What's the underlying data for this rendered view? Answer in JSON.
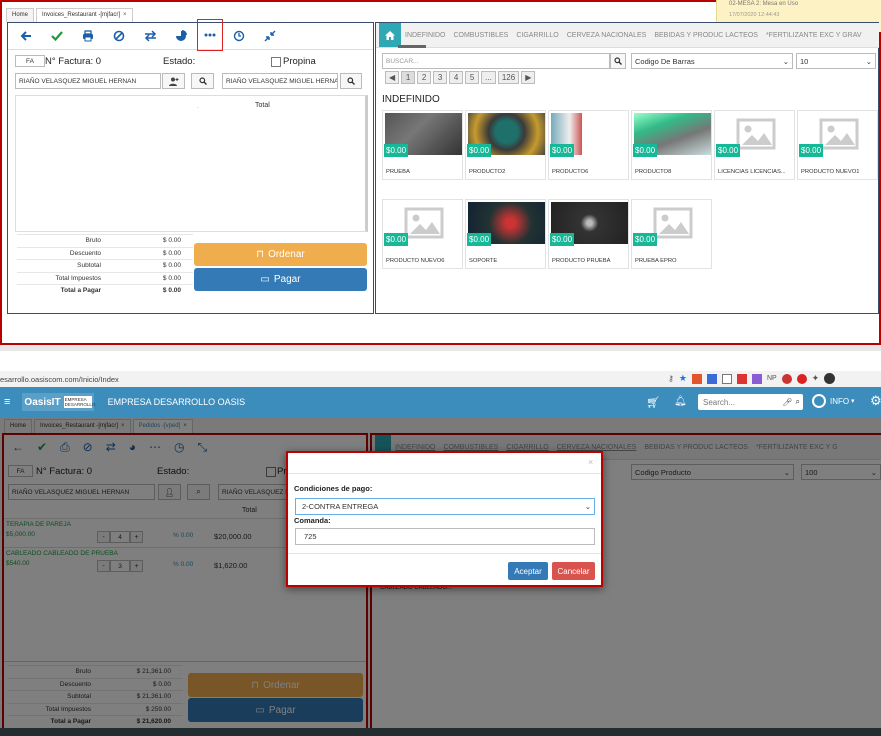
{
  "top": {
    "tabs": [
      {
        "label": "Home"
      },
      {
        "label": "Invoices_Restaurant -[mjfacr]",
        "close": "×"
      }
    ],
    "notification": {
      "line1": "02-MESA 2: Mesa en Uso",
      "line2": "17/07/2020 12:44:43"
    },
    "invoice": {
      "type_code": "FA",
      "number_label": "N° Factura: 0",
      "estado_label": "Estado:",
      "propina_label": "Propina",
      "client_left": "RIAÑO VELASQUEZ MIGUEL HERNAN",
      "client_right": "RIAÑO VELASQUEZ MIGUEL HERNAN",
      "total_header": "Total",
      "dot": "."
    },
    "totals": [
      {
        "k": "Bruto",
        "v": "$ 0.00"
      },
      {
        "k": "Descuento",
        "v": "$ 0.00"
      },
      {
        "k": "Subtotal",
        "v": "$ 0.00"
      },
      {
        "k": "Total Impuestos",
        "v": "$ 0.00"
      },
      {
        "k": "Total a Pagar",
        "v": "$ 0.00"
      }
    ],
    "buttons": {
      "ordenar": "Ordenar",
      "pagar": "Pagar"
    },
    "categories": [
      "INDEFINIDO",
      "COMBUSTIBLES",
      "CIGARRILLO",
      "CERVEZA NACIONALES",
      "BEBIDAS Y PRODUC LACTEOS",
      "*FERTILIZANTE EXC Y GRAV"
    ],
    "search_placeholder": "BUSCAR...",
    "filter_select": "Codigo De Barras",
    "page_size": "10",
    "pager": [
      "◀",
      "1",
      "2",
      "3",
      "4",
      "5",
      "...",
      "126",
      "▶"
    ],
    "section_title": "INDEFINIDO",
    "products": [
      {
        "name": "PRUEBA",
        "price": "$0.00"
      },
      {
        "name": "PRODUCTO2",
        "price": "$0.00"
      },
      {
        "name": "PRODUCTO6",
        "price": "$0.00"
      },
      {
        "name": "PRODUCTO8",
        "price": "$0.00"
      },
      {
        "name": "LICENCIAS LICENCIAS...",
        "price": "$0.00"
      },
      {
        "name": "PRODUCTO NUEVO1",
        "price": "$0.00"
      },
      {
        "name": "PRODUCTO NUEVO6",
        "price": "$0.00"
      },
      {
        "name": "SOPORTE",
        "price": "$0.00"
      },
      {
        "name": "PRODUCTO PRUEBA",
        "price": "$0.00"
      },
      {
        "name": "PRUEBA EPRO",
        "price": "$0.00"
      }
    ]
  },
  "bottom": {
    "url": "esarrollo.oasiscom.com/Inicio/Index",
    "browser_ext_np": "NP",
    "brand": "EMPRESA DESARROLLO OASIS",
    "logo_text": "OasisIT",
    "logo_sub": "EMPRESA DESARROLLO",
    "search_placeholder": "Search...",
    "user": "INFO",
    "tabs": [
      {
        "label": "Home"
      },
      {
        "label": "Invoices_Restaurant -[mjfacr]",
        "close": "×"
      },
      {
        "label": "Pedidos -[vped]",
        "close": "×"
      }
    ],
    "invoice": {
      "type_code": "FA",
      "number_label": "N° Factura: 0",
      "estado_label": "Estado:",
      "propina_label": "Pro",
      "client_left": "RIAÑO VELASQUEZ MIGUEL HERNAN",
      "client_right": "RIAÑO VELASQUEZ MIGUEL HERNAN",
      "total_header": "Total"
    },
    "lines": [
      {
        "name": "TERAPIA DE PAREJA",
        "price": "$5,000.00",
        "qty": "4",
        "pct": "% 0.00",
        "total": "$20,000.00",
        "minus": "-",
        "plus": "+"
      },
      {
        "name": "CABLEADO CABLEADO DE PRUEBA",
        "price": "$540.00",
        "qty": "3",
        "pct": "% 0.00",
        "total": "$1,620.00",
        "minus": "-",
        "plus": "+"
      }
    ],
    "totals": [
      {
        "k": "Bruto",
        "v": "$ 21,361.00"
      },
      {
        "k": "Descuento",
        "v": "$ 0.00"
      },
      {
        "k": "Subtotal",
        "v": "$ 21,361.00"
      },
      {
        "k": "Total Impuestos",
        "v": "$ 259.00"
      },
      {
        "k": "Total a Pagar",
        "v": "$ 21,620.00"
      }
    ],
    "buttons": {
      "ordenar": "Ordenar",
      "pagar": "Pagar"
    },
    "categories": [
      "INDEFINIDO",
      "COMBUSTIBLES",
      "CIGARRILLO",
      "CERVEZA NACIONALES",
      "BEBIDAS Y PRODUC LACTEOS",
      "*FERTILIZANTE EXC Y G"
    ],
    "filter_select": "Codigo Producto",
    "page_size": "100",
    "bg_product": "CABLEADO CABLEADO..."
  },
  "modal": {
    "close": "×",
    "cond_label": "Condiciones de pago:",
    "cond_value": "2-CONTRA ENTREGA",
    "comanda_label": "Comanda:",
    "comanda_value": "725",
    "accept": "Aceptar",
    "cancel": "Cancelar"
  },
  "colors": {
    "accent": "#3c8dbc",
    "teal": "#17b897",
    "orange": "#f0ad4e",
    "blue": "#337ab7",
    "danger": "#d9534f",
    "highlight": "#cc0000"
  }
}
